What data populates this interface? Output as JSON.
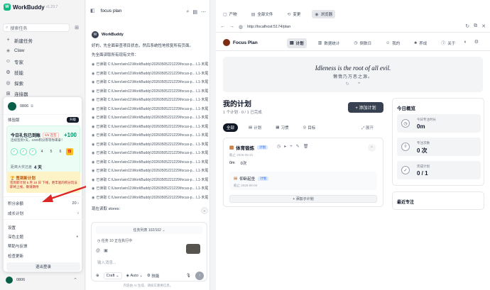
{
  "brand": {
    "name": "WorkBuddy",
    "version": "v1.23.7",
    "logo_letter": "W"
  },
  "sidebar": {
    "search_placeholder": "搜索任务",
    "items": [
      {
        "icon": "plus-icon",
        "glyph": "+",
        "label": "新建任务"
      },
      {
        "icon": "claw-icon",
        "glyph": "✳",
        "label": "Claw"
      },
      {
        "icon": "expert-icon",
        "glyph": "☺",
        "label": "专家"
      },
      {
        "icon": "skill-icon",
        "glyph": "⚙",
        "label": "技能"
      },
      {
        "icon": "explore-icon",
        "glyph": "◎",
        "label": "探索"
      },
      {
        "icon": "connector-icon",
        "glyph": "⊞",
        "label": "连接器"
      }
    ]
  },
  "profile": {
    "username": "0806",
    "tier": "体验版",
    "upgrade_label": "升级",
    "checkin": {
      "title": "今日礼包已到账",
      "badge": "5/6 连签",
      "plus": "+100",
      "subtitle": "连续签到7天，1000积分券等你来拿！",
      "days": [
        "✓",
        "✓",
        "✓",
        "4",
        "5",
        "6"
      ],
      "streak_label": "距离大奖还差",
      "streak_value": "4 天"
    },
    "notice": {
      "title": "签到新计划",
      "body": "签到新计划 5 月 10 日 下线，更丰富的积分玩法即将上线，敬请期待"
    },
    "menu": [
      {
        "label": "积分余额",
        "value": "20 ›"
      },
      {
        "label": "成长计划",
        "value": "›"
      },
      {
        "label": "设置",
        "value": ""
      },
      {
        "label": "深色主题",
        "value": "◐"
      },
      {
        "label": "帮助与反馈",
        "value": ""
      },
      {
        "label": "检查更新",
        "value": ""
      }
    ],
    "logout_label": "退出登录"
  },
  "bottom_user": {
    "name": "0806"
  },
  "chat": {
    "title": "focus plan",
    "bot_name": "WorkBuddy",
    "messages": [
      "好的，先全面审查项目状态，然后系统性地修复所有页面。",
      "先全面读取所有现有文件："
    ],
    "read_lines": [
      "已读取 C:\\Users\\win11\\WorkBuddy\\20260505221229\\focus-p...  L1-末尾",
      "已读取 C:\\Users\\win11\\WorkBuddy\\20260505221229\\focus-p...  L1-末尾",
      "已读取 C:\\Users\\win11\\WorkBuddy\\20260505221229\\focus-p...  L1-末尾",
      "已读取 C:\\Users\\win11\\WorkBuddy\\20260505221229\\focus-p...  L1-末尾",
      "已读取 C:\\Users\\win11\\WorkBuddy\\20260505221229\\focus-p...  L1-末尾",
      "已读取 C:\\Users\\win11\\WorkBuddy\\20260505221229\\focus-p...  L1-末尾",
      "已读取 C:\\Users\\win11\\WorkBuddy\\20260505221229\\focus-p...  L1-末尾",
      "已读取 C:\\Users\\win11\\WorkBuddy\\20260505221229\\focus-p...  L1-末尾",
      "已读取 C:\\Users\\win11\\WorkBuddy\\20260505221229\\focus-p...  L1-末尾",
      "已读取 C:\\Users\\win11\\WorkBuddy\\20260505221229\\focus-p...  L1-末尾",
      "已读取 C:\\Users\\win11\\WorkBuddy\\20260505221229\\focus-p...  L1-末尾",
      "已读取 C:\\Users\\win11\\WorkBuddy\\20260505221229\\focus-p...  L1-末尾",
      "已读取 C:\\Users\\win11\\WorkBuddy\\20260505221229\\focus-p...  L1-末尾",
      "已读取 C:\\Users\\win11\\WorkBuddy\\20260505221229\\focus-p...  L1-末尾",
      "已读取 C:\\Users\\win11\\WorkBuddy\\20260505221229\\focus-p...  L1-末尾",
      "已读取 C:\\Users\\win11\\WorkBuddy\\20260505221229\\focus-p...  L1-末尾"
    ],
    "last_message": "现在读取 stores:",
    "composer": {
      "task_list": "任务列表 102/102",
      "task_running": "任务 10 正在执行中",
      "placeholder": "输入消息...",
      "mode": "Craft",
      "model": "Auto",
      "skill": "技能"
    },
    "footer": "内容由 AI 生成，请核实重要信息。"
  },
  "browser": {
    "tabs": [
      {
        "icon": "product-icon",
        "glyph": "▢",
        "label": "产物"
      },
      {
        "icon": "files-icon",
        "glyph": "▤",
        "label": "全部文件"
      },
      {
        "icon": "changes-icon",
        "glyph": "⟲",
        "label": "变更"
      },
      {
        "icon": "browser-icon",
        "glyph": "◉",
        "label": "浏览器"
      }
    ],
    "url": "http://localhost:5174/plan"
  },
  "app": {
    "title": "Focus Plan",
    "nav": [
      {
        "icon": "plan-icon",
        "glyph": "▤",
        "label": "计划"
      },
      {
        "icon": "stats-icon",
        "glyph": "▥",
        "label": "数据统计"
      },
      {
        "icon": "timer-icon",
        "glyph": "◷",
        "label": "倒数日"
      },
      {
        "icon": "mine-icon",
        "glyph": "☺",
        "label": "我的"
      },
      {
        "icon": "sprout-icon",
        "glyph": "♣",
        "label": "养成"
      },
      {
        "icon": "info-icon",
        "glyph": "ⓘ",
        "label": "关于"
      }
    ],
    "quote_en": "Idleness is the root of all evil.",
    "quote_zh": "懒惰乃万恶之源。",
    "plans_title": "我的计划",
    "plans_sub": "1 个计划 · 0 / 1 已完成",
    "add_plan_label": "+ 添加计划",
    "filters": [
      {
        "label": "全部",
        "glyph": ""
      },
      {
        "label": "计划",
        "glyph": "▤"
      },
      {
        "label": "习惯",
        "glyph": "▦"
      },
      {
        "label": "目标",
        "glyph": "◎"
      }
    ],
    "expand_label": "⤢ 展开",
    "plan": {
      "name": "体育锻炼",
      "tag": "计划",
      "date": "截止 2026-05-21",
      "stat1": "0m",
      "stat2": "0次",
      "sub_name": "仰卧起坐",
      "sub_tag": "计划",
      "sub_date": "截止 2026-06-04",
      "add_sub_label": "+ 添加子计划"
    },
    "overview": {
      "title": "今日概览",
      "stats": [
        {
          "icon": "clock-icon",
          "glyph": "◷",
          "label": "今日专注时长",
          "value": "0m"
        },
        {
          "icon": "drop-icon",
          "glyph": "◊",
          "label": "专注次数",
          "value": "0 次"
        },
        {
          "icon": "check-icon",
          "glyph": "✓",
          "label": "完成计划",
          "value": "0 / 1"
        }
      ]
    },
    "recent_title": "最近专注"
  }
}
